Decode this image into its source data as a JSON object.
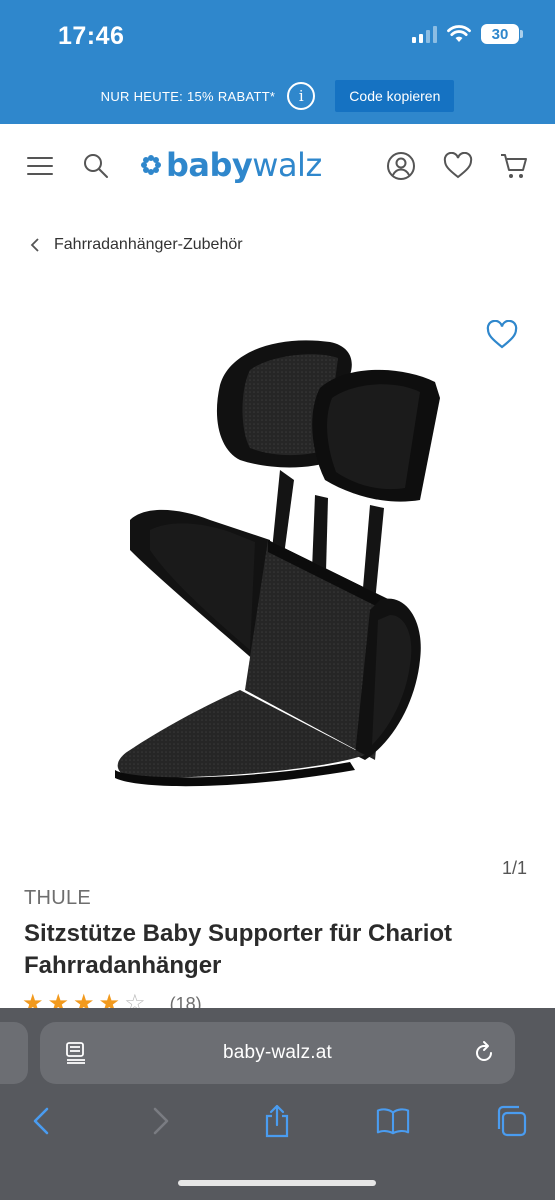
{
  "status_bar": {
    "time": "17:46",
    "battery": "30"
  },
  "promo": {
    "text": "NUR HEUTE: 15% RABATT*",
    "info_icon": "info-icon",
    "button_label": "Code kopieren"
  },
  "header": {
    "menu_icon": "menu-icon",
    "search_icon": "search-icon",
    "logo": {
      "part1": "baby",
      "part2": "walz"
    },
    "account_icon": "account-icon",
    "wishlist_icon": "heart-icon",
    "cart_icon": "cart-icon",
    "brand_color": "#2f87cc"
  },
  "breadcrumb": {
    "label": "Fahrradanhänger-Zubehör"
  },
  "product": {
    "image_pager": "1/1",
    "brand": "THULE",
    "title": "Sitzstütze Baby Supporter für Chariot Fahrradanhänger",
    "rating": {
      "stars": 4,
      "max": 5,
      "count": "(18)"
    }
  },
  "browser": {
    "url": "baby-walz.at",
    "back_icon": "back-icon",
    "forward_icon": "forward-icon",
    "share_icon": "share-icon",
    "bookmarks_icon": "book-icon",
    "tabs_icon": "tabs-icon"
  }
}
